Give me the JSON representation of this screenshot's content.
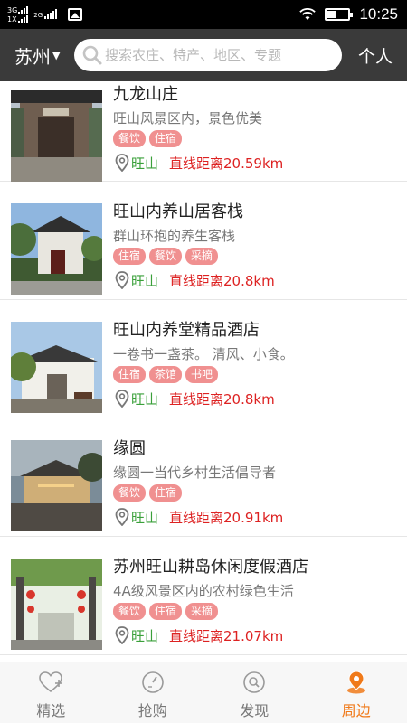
{
  "status_bar": {
    "network_1": "3G",
    "network_2": "1X",
    "network_3": "2G",
    "time": "10:25"
  },
  "header": {
    "city": "苏州",
    "search_placeholder": "搜索农庄、特产、地区、专题",
    "profile_label": "个人"
  },
  "listings": [
    {
      "name": "九龙山庄",
      "desc": "旺山风景区内，景色优美",
      "tags": [
        "餐饮",
        "住宿"
      ],
      "location": "旺山",
      "distance": "直线距离20.59km"
    },
    {
      "name": "旺山内养山居客栈",
      "desc": "群山环抱的养生客栈",
      "tags": [
        "住宿",
        "餐饮",
        "采摘"
      ],
      "location": "旺山",
      "distance": "直线距离20.8km"
    },
    {
      "name": "旺山内养堂精品酒店",
      "desc": "一卷书一盏茶。 清风、小食。",
      "tags": [
        "住宿",
        "茶馆",
        "书吧"
      ],
      "location": "旺山",
      "distance": "直线距离20.8km"
    },
    {
      "name": "缘圆",
      "desc": "缘圆一当代乡村生活倡导者",
      "tags": [
        "餐饮",
        "住宿"
      ],
      "location": "旺山",
      "distance": "直线距离20.91km"
    },
    {
      "name": "苏州旺山耕岛休闲度假酒店",
      "desc": "4A级风景区内的农村绿色生活",
      "tags": [
        "餐饮",
        "住宿",
        "采摘"
      ],
      "location": "旺山",
      "distance": "直线距离21.07km"
    }
  ],
  "bottom_nav": [
    {
      "label": "精选",
      "icon": "heart-plus-icon"
    },
    {
      "label": "抢购",
      "icon": "timer-icon"
    },
    {
      "label": "发现",
      "icon": "search-circle-icon"
    },
    {
      "label": "周边",
      "icon": "location-pin-icon",
      "active": true
    }
  ],
  "colors": {
    "header_bg": "#3a3a3a",
    "tag_bg": "#f09090",
    "location_green": "#3aa03a",
    "distance_red": "#dd2222",
    "nav_active": "#f07a1a"
  }
}
